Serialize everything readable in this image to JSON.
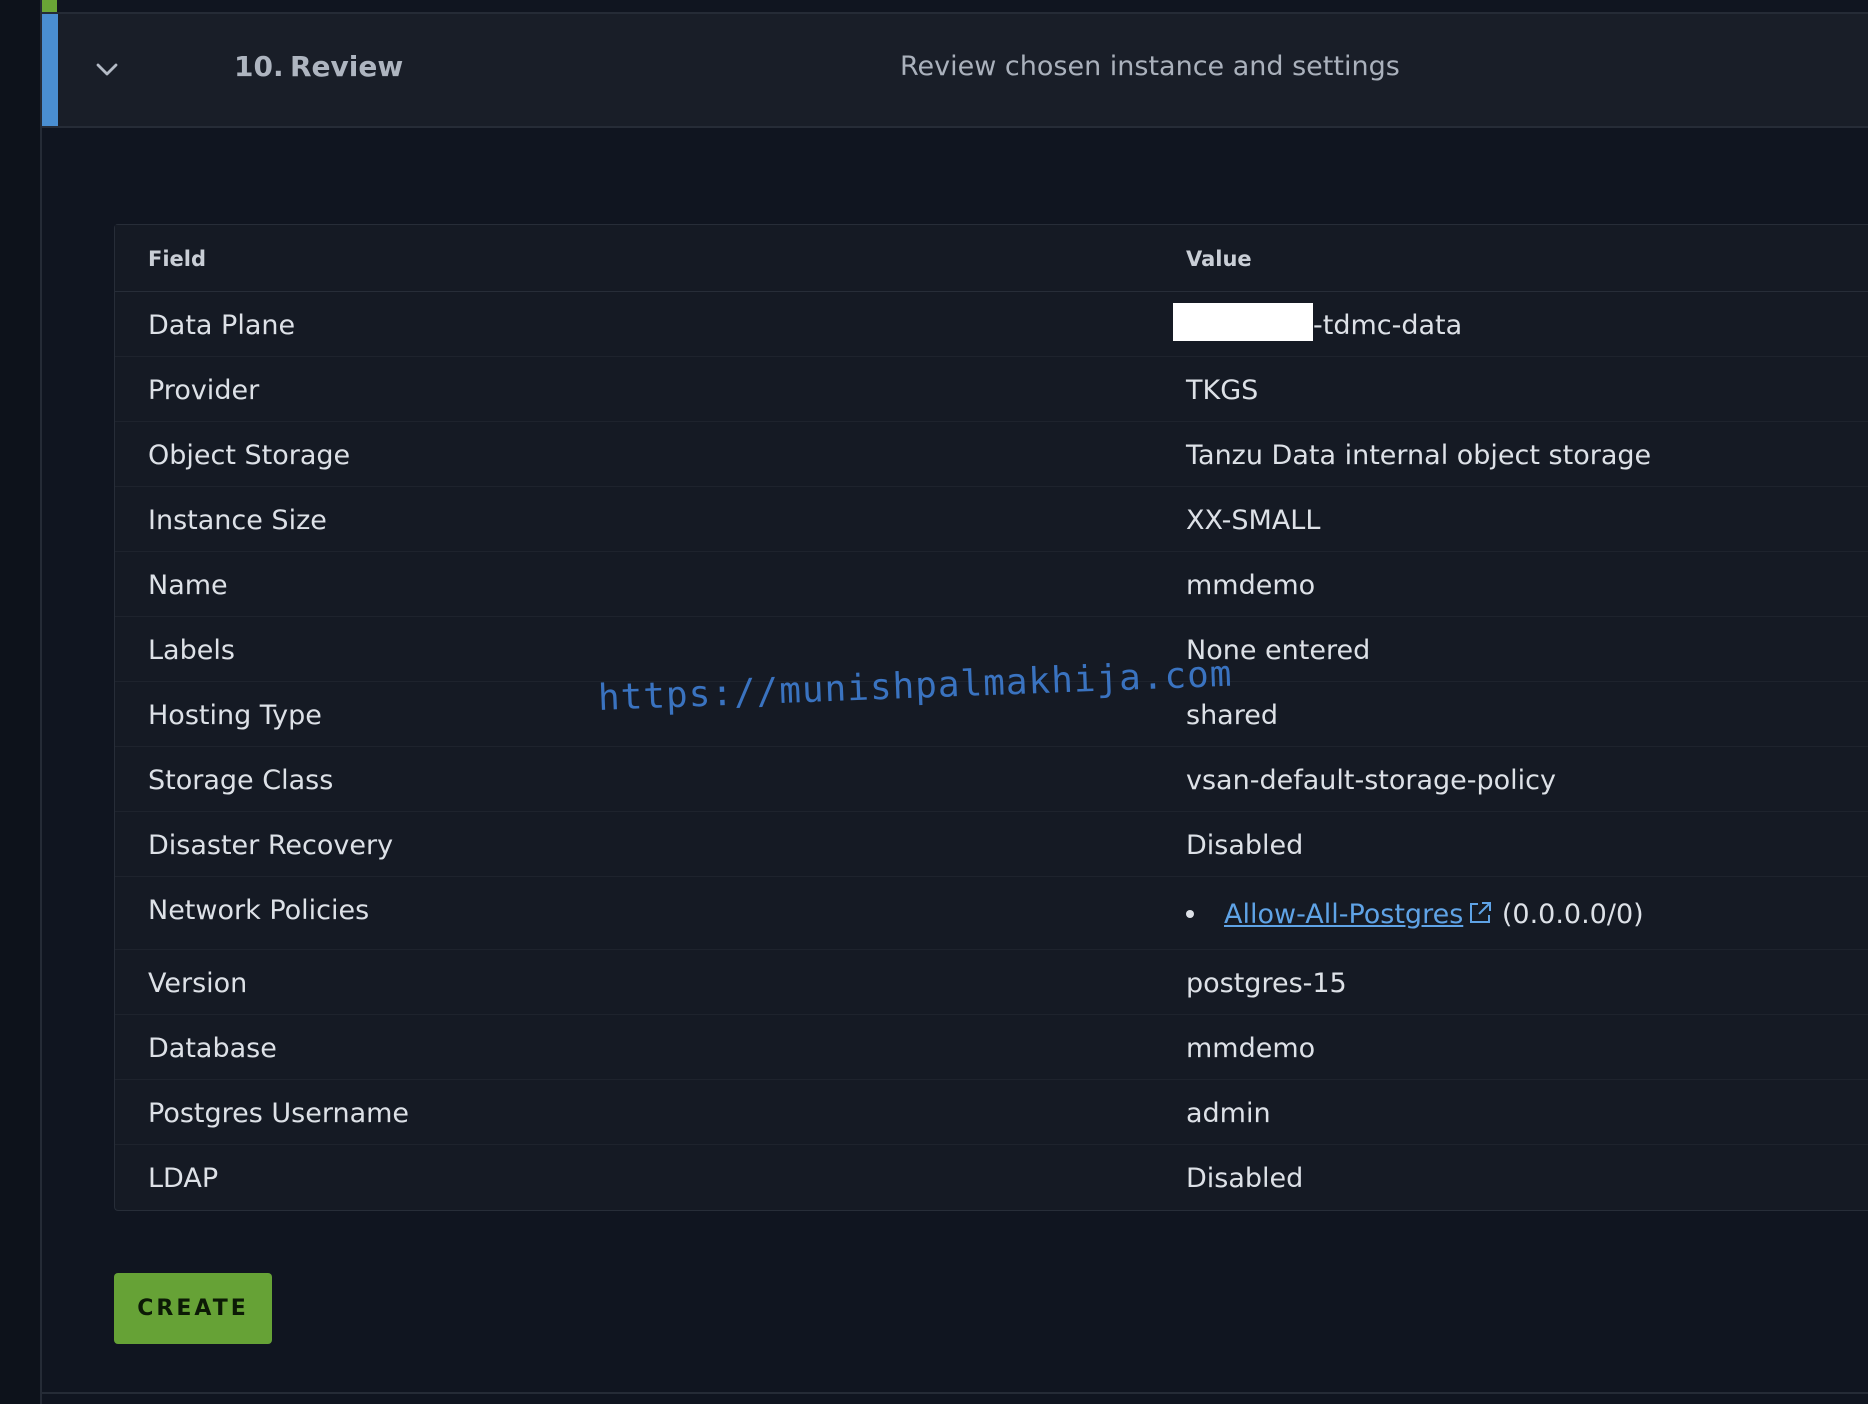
{
  "step": {
    "number": "10.",
    "title": "Review",
    "description": "Review chosen instance and settings"
  },
  "table": {
    "headers": {
      "field": "Field",
      "value": "Value"
    },
    "rows": [
      {
        "field": "Data Plane",
        "value": "-tdmc-data"
      },
      {
        "field": "Provider",
        "value": "TKGS"
      },
      {
        "field": "Object Storage",
        "value": "Tanzu Data internal object storage"
      },
      {
        "field": "Instance Size",
        "value": "XX-SMALL"
      },
      {
        "field": "Name",
        "value": "mmdemo"
      },
      {
        "field": "Labels",
        "value": "None entered"
      },
      {
        "field": "Hosting Type",
        "value": "shared"
      },
      {
        "field": "Storage Class",
        "value": "vsan-default-storage-policy"
      },
      {
        "field": "Disaster Recovery",
        "value": "Disabled"
      },
      {
        "field": "Network Policies",
        "link": "Allow-All-Postgres",
        "value": "(0.0.0.0/0)"
      },
      {
        "field": "Version",
        "value": "postgres-15"
      },
      {
        "field": "Database",
        "value": "mmdemo"
      },
      {
        "field": "Postgres Username",
        "value": "admin"
      },
      {
        "field": "LDAP",
        "value": "Disabled"
      }
    ]
  },
  "watermark": "https://munishpalmakhija.com",
  "create_label": "CREATE",
  "icons": {
    "chevron": "chevron-down-icon",
    "external_link": "external-link-icon"
  },
  "colors": {
    "accent_blue": "#4a8ed1",
    "create_green": "#66a236",
    "link_blue": "#5fa3e6",
    "background": "#101520"
  }
}
